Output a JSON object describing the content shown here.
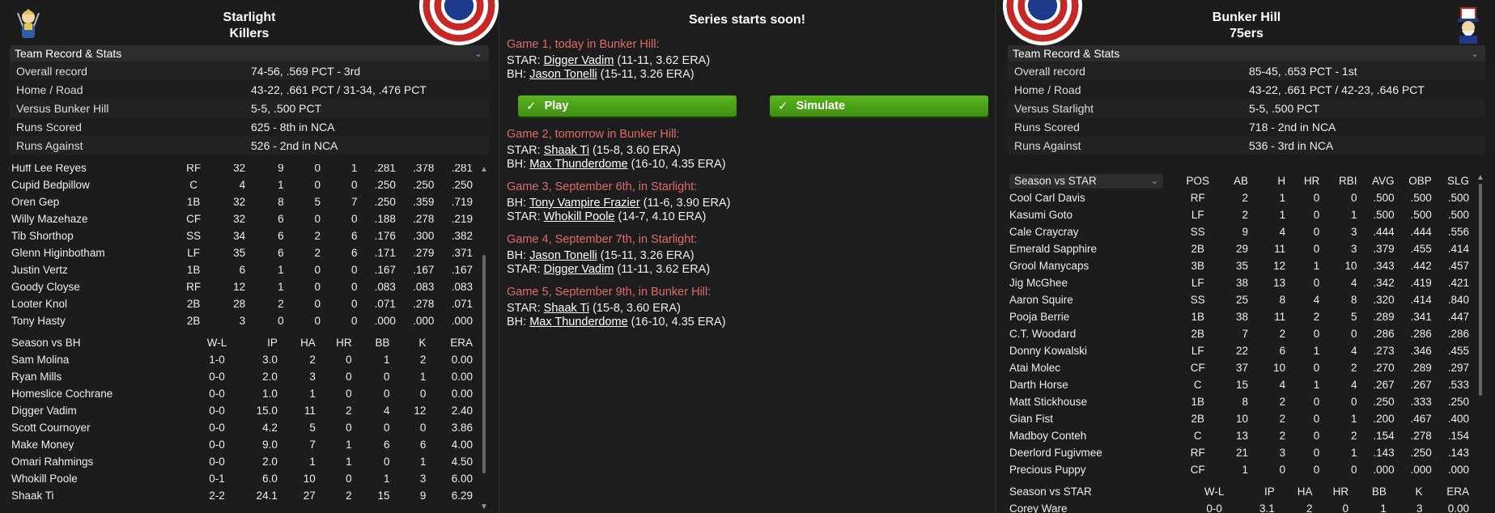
{
  "left": {
    "team_line1": "Starlight",
    "team_line2": "Killers",
    "section_label": "Team Record & Stats",
    "stats": [
      {
        "label": "Overall record",
        "value": "74-56, .569 PCT - 3rd"
      },
      {
        "label": "Home / Road",
        "value": "43-22, .661 PCT / 31-34, .476 PCT"
      },
      {
        "label": "Versus Bunker Hill",
        "value": "5-5, .500 PCT"
      },
      {
        "label": "Runs Scored",
        "value": "625 - 8th in NCA"
      },
      {
        "label": "Runs Against",
        "value": "526 - 2nd in NCA"
      }
    ],
    "batters": [
      [
        "Huff Lee Reyes",
        "RF",
        "32",
        "9",
        "0",
        "1",
        ".281",
        ".378",
        ".281"
      ],
      [
        "Cupid Bedpillow",
        "C",
        "4",
        "1",
        "0",
        "0",
        ".250",
        ".250",
        ".250"
      ],
      [
        "Oren Gep",
        "1B",
        "32",
        "8",
        "5",
        "7",
        ".250",
        ".359",
        ".719"
      ],
      [
        "Willy Mazehaze",
        "CF",
        "32",
        "6",
        "0",
        "0",
        ".188",
        ".278",
        ".219"
      ],
      [
        "Tib Shorthop",
        "SS",
        "34",
        "6",
        "2",
        "6",
        ".176",
        ".300",
        ".382"
      ],
      [
        "Glenn Higinbotham",
        "LF",
        "35",
        "6",
        "2",
        "6",
        ".171",
        ".279",
        ".371"
      ],
      [
        "Justin Vertz",
        "1B",
        "6",
        "1",
        "0",
        "0",
        ".167",
        ".167",
        ".167"
      ],
      [
        "Goody Cloyse",
        "RF",
        "12",
        "1",
        "0",
        "0",
        ".083",
        ".083",
        ".083"
      ],
      [
        "Looter Knol",
        "2B",
        "28",
        "2",
        "0",
        "0",
        ".071",
        ".278",
        ".071"
      ],
      [
        "Tony Hasty",
        "2B",
        "3",
        "0",
        "0",
        "0",
        ".000",
        ".000",
        ".000"
      ]
    ],
    "pitch_header": [
      "Season vs BH",
      "W-L",
      "IP",
      "HA",
      "HR",
      "BB",
      "K",
      "ERA"
    ],
    "pitchers": [
      [
        "Sam Molina",
        "1-0",
        "3.0",
        "2",
        "0",
        "1",
        "2",
        "0.00"
      ],
      [
        "Ryan Mills",
        "0-0",
        "2.0",
        "3",
        "0",
        "0",
        "1",
        "0.00"
      ],
      [
        "Homeslice Cochrane",
        "0-0",
        "1.0",
        "1",
        "0",
        "0",
        "0",
        "0.00"
      ],
      [
        "Digger Vadim",
        "0-0",
        "15.0",
        "11",
        "2",
        "4",
        "12",
        "2.40"
      ],
      [
        "Scott Cournoyer",
        "0-0",
        "4.2",
        "5",
        "0",
        "0",
        "0",
        "3.86"
      ],
      [
        "Make Money",
        "0-0",
        "9.0",
        "7",
        "1",
        "6",
        "6",
        "4.00"
      ],
      [
        "Omari Rahmings",
        "0-0",
        "2.0",
        "1",
        "1",
        "0",
        "1",
        "4.50"
      ],
      [
        "Whokill Poole",
        "0-1",
        "6.0",
        "10",
        "0",
        "1",
        "3",
        "6.00"
      ],
      [
        "Shaak Ti",
        "2-2",
        "24.1",
        "27",
        "2",
        "15",
        "9",
        "6.29"
      ]
    ]
  },
  "center": {
    "title": "Series starts soon!",
    "play_label": "Play",
    "simulate_label": "Simulate",
    "games": [
      {
        "head": "Game 1, today in Bunker Hill:",
        "lines": [
          {
            "prefix": "STAR: ",
            "name": "Digger Vadim",
            "stats": " (11-11, 3.62 ERA)"
          },
          {
            "prefix": "BH: ",
            "name": "Jason Tonelli",
            "stats": " (15-11, 3.26 ERA)"
          }
        ]
      },
      {
        "head": "Game 2, tomorrow in Bunker Hill:",
        "lines": [
          {
            "prefix": "STAR: ",
            "name": "Shaak Ti",
            "stats": " (15-8, 3.60 ERA)"
          },
          {
            "prefix": "BH: ",
            "name": "Max Thunderdome",
            "stats": " (16-10, 4.35 ERA)"
          }
        ]
      },
      {
        "head": "Game 3, September 6th,  in Starlight:",
        "lines": [
          {
            "prefix": "BH: ",
            "name": "Tony Vampire Frazier",
            "stats": " (11-6, 3.90 ERA)"
          },
          {
            "prefix": "STAR: ",
            "name": "Whokill Poole",
            "stats": " (14-7, 4.10 ERA)"
          }
        ]
      },
      {
        "head": "Game 4, September 7th,  in Starlight:",
        "lines": [
          {
            "prefix": "BH: ",
            "name": "Jason Tonelli",
            "stats": " (15-11, 3.26 ERA)"
          },
          {
            "prefix": "STAR: ",
            "name": "Digger Vadim",
            "stats": " (11-11, 3.62 ERA)"
          }
        ]
      },
      {
        "head": "Game 5, September 9th,  in Bunker Hill:",
        "lines": [
          {
            "prefix": "STAR: ",
            "name": "Shaak Ti",
            "stats": " (15-8, 3.60 ERA)"
          },
          {
            "prefix": "BH: ",
            "name": "Max Thunderdome",
            "stats": " (16-10, 4.35 ERA)"
          }
        ]
      }
    ]
  },
  "right": {
    "team_line1": "Bunker Hill",
    "team_line2": "75ers",
    "section_label": "Team Record & Stats",
    "stats": [
      {
        "label": "Overall record",
        "value": "85-45, .653 PCT - 1st"
      },
      {
        "label": "Home / Road",
        "value": "43-22, .661 PCT / 42-23, .646 PCT"
      },
      {
        "label": "Versus Starlight",
        "value": "5-5, .500 PCT"
      },
      {
        "label": "Runs Scored",
        "value": "718 - 2nd in NCA"
      },
      {
        "label": "Runs Against",
        "value": "536 - 3rd in NCA"
      }
    ],
    "bat_select": "Season vs STAR",
    "bat_header": [
      "POS",
      "AB",
      "H",
      "HR",
      "RBI",
      "AVG",
      "OBP",
      "SLG"
    ],
    "batters": [
      [
        "Cool Carl Davis",
        "RF",
        "2",
        "1",
        "0",
        "0",
        ".500",
        ".500",
        ".500"
      ],
      [
        "Kasumi Goto",
        "LF",
        "2",
        "1",
        "0",
        "1",
        ".500",
        ".500",
        ".500"
      ],
      [
        "Cale Craycray",
        "SS",
        "9",
        "4",
        "0",
        "3",
        ".444",
        ".444",
        ".556"
      ],
      [
        "Emerald Sapphire",
        "2B",
        "29",
        "11",
        "0",
        "3",
        ".379",
        ".455",
        ".414"
      ],
      [
        "Grool Manycaps",
        "3B",
        "35",
        "12",
        "1",
        "10",
        ".343",
        ".442",
        ".457"
      ],
      [
        "Jig McGhee",
        "LF",
        "38",
        "13",
        "0",
        "4",
        ".342",
        ".419",
        ".421"
      ],
      [
        "Aaron Squire",
        "SS",
        "25",
        "8",
        "4",
        "8",
        ".320",
        ".414",
        ".840"
      ],
      [
        "Pooja Berrie",
        "1B",
        "38",
        "11",
        "2",
        "5",
        ".289",
        ".341",
        ".447"
      ],
      [
        "C.T. Woodard",
        "2B",
        "7",
        "2",
        "0",
        "0",
        ".286",
        ".286",
        ".286"
      ],
      [
        "Donny Kowalski",
        "LF",
        "22",
        "6",
        "1",
        "4",
        ".273",
        ".346",
        ".455"
      ],
      [
        "Atai Molec",
        "CF",
        "37",
        "10",
        "0",
        "2",
        ".270",
        ".289",
        ".297"
      ],
      [
        "Darth Horse",
        "C",
        "15",
        "4",
        "1",
        "4",
        ".267",
        ".267",
        ".533"
      ],
      [
        "Matt Stickhouse",
        "1B",
        "8",
        "2",
        "0",
        "0",
        ".250",
        ".333",
        ".250"
      ],
      [
        "Gian Fist",
        "2B",
        "10",
        "2",
        "0",
        "1",
        ".200",
        ".467",
        ".400"
      ],
      [
        "Madboy Conteh",
        "C",
        "13",
        "2",
        "0",
        "2",
        ".154",
        ".278",
        ".154"
      ],
      [
        "Deerlord Fugivmee",
        "RF",
        "21",
        "3",
        "0",
        "1",
        ".143",
        ".250",
        ".143"
      ],
      [
        "Precious Puppy",
        "CF",
        "1",
        "0",
        "0",
        "0",
        ".000",
        ".000",
        ".000"
      ]
    ],
    "pitch_header": [
      "Season vs STAR",
      "W-L",
      "IP",
      "HA",
      "HR",
      "BB",
      "K",
      "ERA"
    ],
    "pitchers": [
      [
        "Corey Ware",
        "0-0",
        "3.1",
        "2",
        "0",
        "1",
        "3",
        "0.00"
      ]
    ]
  }
}
